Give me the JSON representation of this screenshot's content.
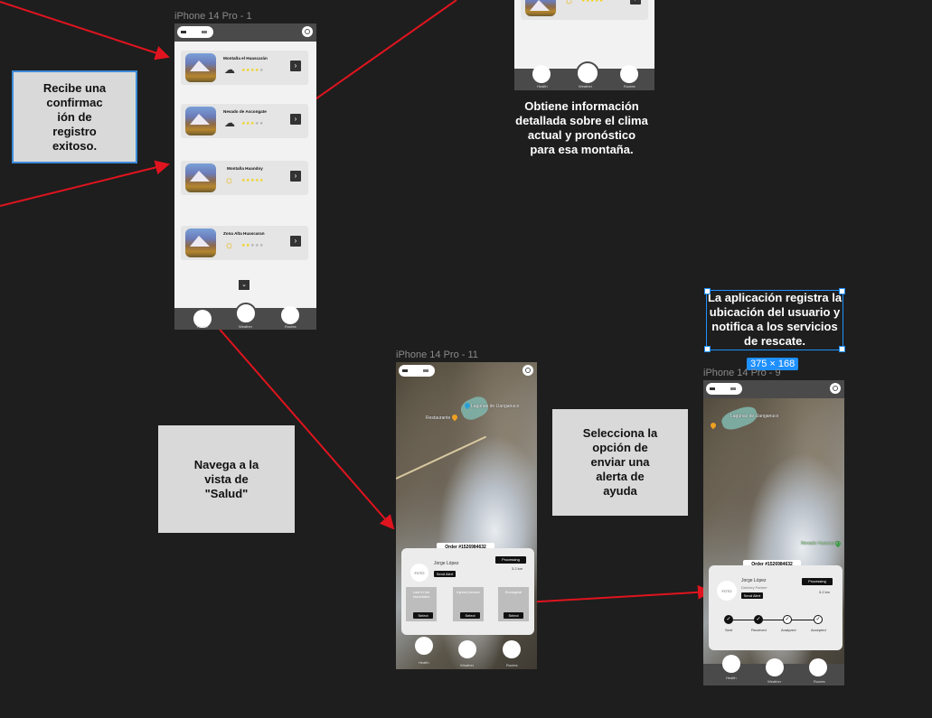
{
  "frames": {
    "list_label": "iPhone 14 Pro - 1",
    "map_label": "iPhone 14 Pro - 11",
    "alert_label": "iPhone 14 Pro - 9",
    "size_badge": "375 × 168"
  },
  "notes": {
    "confirmation": "Recibe una confirmac ión de registro exitoso.",
    "weather_info": "Obtiene información detallada sobre el clima actual y pronóstico para esa montaña.",
    "register_location": "La aplicación registra la ubicación del usuario y notifica a los servicios de rescate.",
    "navigate_health": "Navega a la vista de \"Salud\"",
    "select_alert": "Selecciona la opción de enviar una alerta de ayuda"
  },
  "nav": {
    "health": "Health",
    "weather": "Weather",
    "routes": "Routes"
  },
  "mountains": [
    {
      "name": "Montaña el Huascarán",
      "weather": "cloud-icon",
      "stars": "★★★★★",
      "rating": 4
    },
    {
      "name": "Nevado de Ascongate",
      "weather": "cloud-sun-icon",
      "stars": "★★★★★",
      "rating": 3
    },
    {
      "name": "Montaña Huandoy",
      "weather": "sun-icon",
      "stars": "★★★★★",
      "rating": 5
    },
    {
      "name": "Zona Alta Huascaran",
      "weather": "sun-icon",
      "stars": "★★★★★",
      "rating": 2
    }
  ],
  "map": {
    "place1": "Lagunas de Llanganuco",
    "place2": "Restaurante",
    "place3": "Nevado Huascarán"
  },
  "order": {
    "id": "Order #1526984632",
    "name": "Jorge López",
    "role": "Delivery Partner",
    "status": "Processing",
    "distance": "3.2 km",
    "photo": "FOTO",
    "send_alert": "Send Alert",
    "options": [
      "Last In the mountains",
      "Injured person",
      "Ecological"
    ],
    "select": "Select",
    "steps": [
      "Sent",
      "Received",
      "Analyzed",
      "Accepted"
    ]
  },
  "colors": {
    "background": "#1e1e1e",
    "arrow": "#e0141e",
    "selection": "#1e90ff",
    "star_on": "#f5d000",
    "star_off": "#aaaaaa"
  }
}
